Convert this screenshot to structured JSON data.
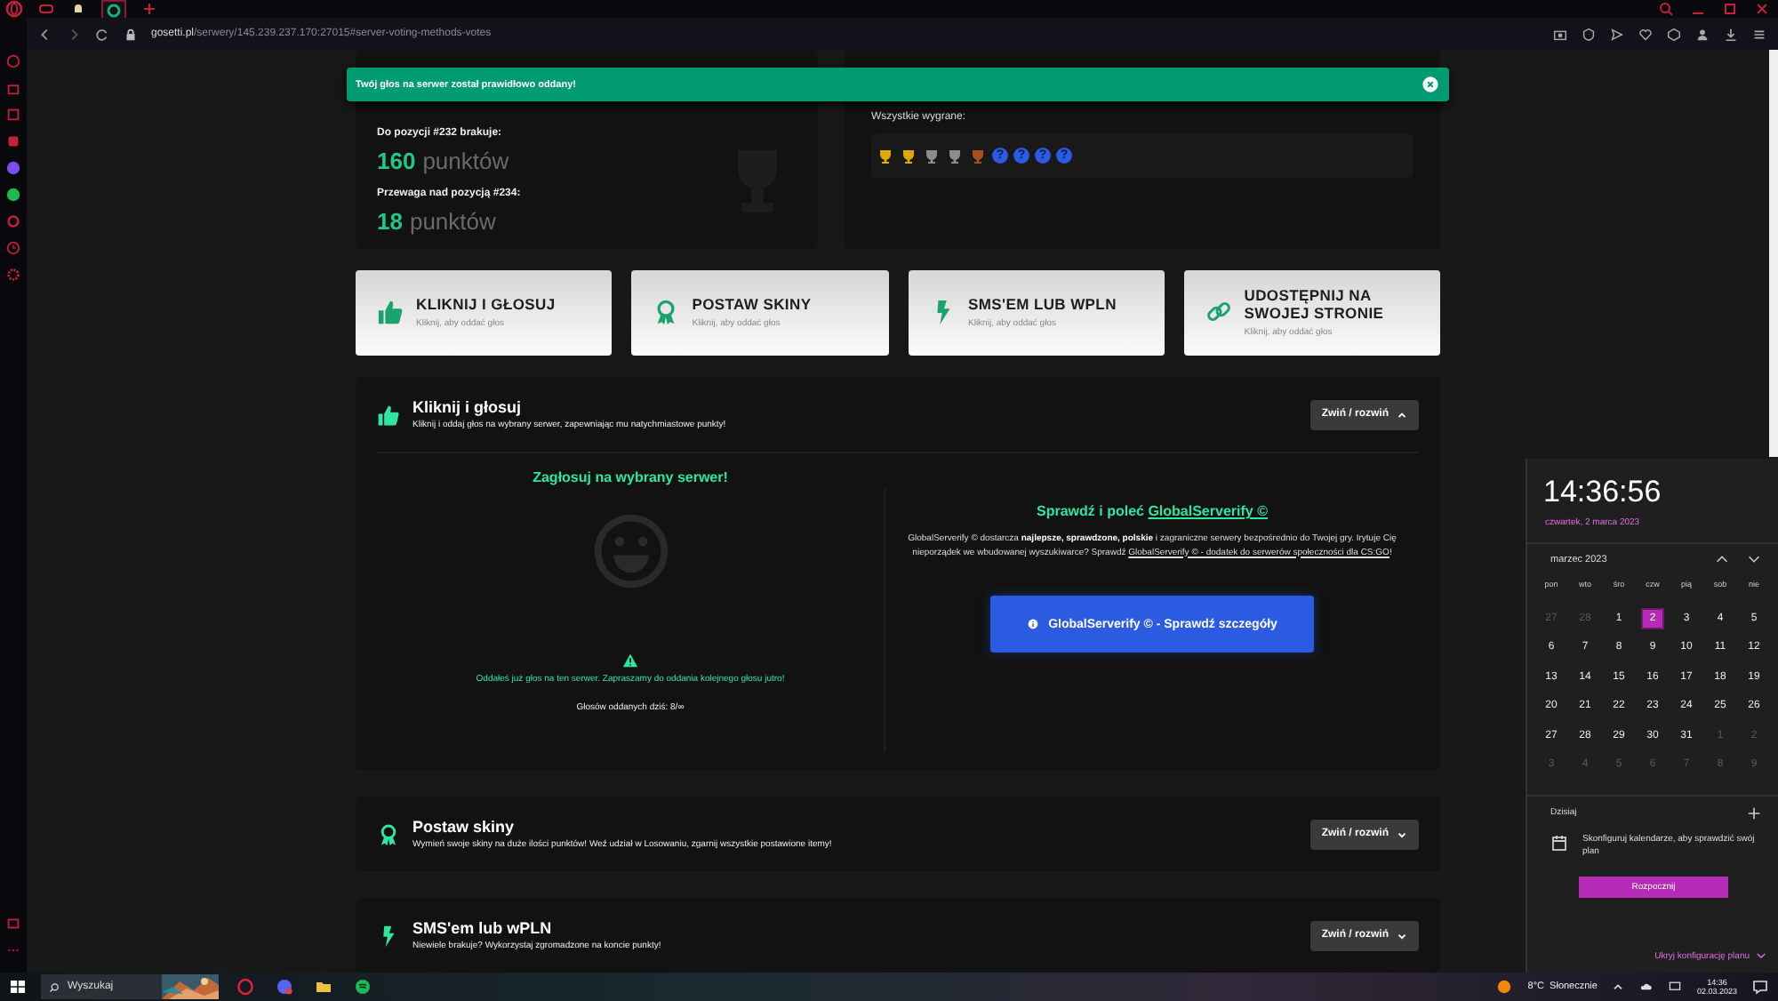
{
  "browser": {
    "url": "**gosetti.pl**/serwery/145.239.237.170:27015#server-voting-methods-votes"
  },
  "toast": {
    "message": "Twój głos na serwer został prawidłowo oddany!"
  },
  "stats": [
    {
      "label": "Do pozycji #232 brakuje:",
      "value": "160",
      "unit": "punktów"
    },
    {
      "label": "Przewaga nad pozycją #234:",
      "value": "18",
      "unit": "punktów"
    }
  ],
  "wins": {
    "label": "Wszystkie wygrane:",
    "items": [
      {
        "kind": "gold"
      },
      {
        "kind": "gold"
      },
      {
        "kind": "silver"
      },
      {
        "kind": "silver"
      },
      {
        "kind": "bronze"
      },
      {
        "kind": "unknown",
        "label": "?"
      },
      {
        "kind": "unknown",
        "label": "?"
      },
      {
        "kind": "unknown",
        "label": "?"
      },
      {
        "kind": "unknown",
        "label": "?"
      }
    ]
  },
  "vote_methods": [
    {
      "kind": "thumb",
      "title": "KLIKNIJ I GŁOSUJ",
      "subtitle": "Kliknij, aby oddać głos"
    },
    {
      "kind": "award",
      "title": "POSTAW SKINY",
      "subtitle": "Kliknij, aby oddać głos"
    },
    {
      "kind": "bolt",
      "title": "SMS'EM LUB WPLN",
      "subtitle": "Kliknij, aby oddać głos"
    },
    {
      "kind": "link",
      "title": "UDOSTĘPNIJ NA SWOJEJ STRONIE",
      "subtitle": "Kliknij, aby oddać głos"
    }
  ],
  "sections": [
    {
      "kind": "thumb",
      "title": "Kliknij i głosuj",
      "description": "Kliknij i oddaj głos na wybrany serwer, zapewniając mu natychmiastowe punkty!",
      "toggle": "Zwiń / rozwiń",
      "expanded": true
    },
    {
      "kind": "award",
      "title": "Postaw skiny",
      "description": "Wymień swoje skiny na duże ilości punktów! Weź udział w Losowaniu, zgarnij wszystkie postawione itemy!",
      "toggle": "Zwiń / rozwiń",
      "expanded": false
    },
    {
      "kind": "bolt",
      "title": "SMS'em lub wPLN",
      "description": "Niewiele brakuje? Wykorzystaj zgromadzone na koncie punkty!",
      "toggle": "Zwiń / rozwiń",
      "expanded": false
    }
  ],
  "vote_panel": {
    "heading": "Zagłosuj na wybrany serwer!",
    "notice": "Oddałeś już głos na ten serwer. Zapraszamy do oddania kolejnego głosu jutro!",
    "count": "Głosów oddanych dziś: 8/∞"
  },
  "promo": {
    "heading": "Sprawdź i poleć ",
    "heading_link": "GlobalServerify ©",
    "text_before": "GlobalServerify © dostarcza **najlepsze, sprawdzone, polskie** i zagraniczne serwery bezpośrednio do Twojej gry. Irytuje Cię nieporządek we wbudowanej wyszukiwarce? Sprawdź ",
    "link": "GlobalServerify © - dodatek do serwerów społeczności dla CS:GO",
    "text_after": "!",
    "button": "GlobalServerify © - Sprawdź szczegóły"
  },
  "calendar": {
    "time": "14:36:56",
    "date": "czwartek, 2 marca 2023",
    "month": "marzec 2023",
    "weekdays": [
      "pon",
      "wto",
      "śro",
      "czw",
      "pią",
      "sob",
      "nie"
    ],
    "days": [
      {
        "day": "27",
        "in_month": false,
        "selected": false
      },
      {
        "day": "28",
        "in_month": false,
        "selected": false
      },
      {
        "day": "1",
        "in_month": true,
        "selected": false
      },
      {
        "day": "2",
        "in_month": true,
        "selected": true
      },
      {
        "day": "3",
        "in_month": true,
        "selected": false
      },
      {
        "day": "4",
        "in_month": true,
        "selected": false
      },
      {
        "day": "5",
        "in_month": true,
        "selected": false
      },
      {
        "day": "6",
        "in_month": true,
        "selected": false
      },
      {
        "day": "7",
        "in_month": true,
        "selected": false
      },
      {
        "day": "8",
        "in_month": true,
        "selected": false
      },
      {
        "day": "9",
        "in_month": true,
        "selected": false
      },
      {
        "day": "10",
        "in_month": true,
        "selected": false
      },
      {
        "day": "11",
        "in_month": true,
        "selected": false
      },
      {
        "day": "12",
        "in_month": true,
        "selected": false
      },
      {
        "day": "13",
        "in_month": true,
        "selected": false
      },
      {
        "day": "14",
        "in_month": true,
        "selected": false
      },
      {
        "day": "15",
        "in_month": true,
        "selected": false
      },
      {
        "day": "16",
        "in_month": true,
        "selected": false
      },
      {
        "day": "17",
        "in_month": true,
        "selected": false
      },
      {
        "day": "18",
        "in_month": true,
        "selected": false
      },
      {
        "day": "19",
        "in_month": true,
        "selected": false
      },
      {
        "day": "20",
        "in_month": true,
        "selected": false
      },
      {
        "day": "21",
        "in_month": true,
        "selected": false
      },
      {
        "day": "22",
        "in_month": true,
        "selected": false
      },
      {
        "day": "23",
        "in_month": true,
        "selected": false
      },
      {
        "day": "24",
        "in_month": true,
        "selected": false
      },
      {
        "day": "25",
        "in_month": true,
        "selected": false
      },
      {
        "day": "26",
        "in_month": true,
        "selected": false
      },
      {
        "day": "27",
        "in_month": true,
        "selected": false
      },
      {
        "day": "28",
        "in_month": true,
        "selected": false
      },
      {
        "day": "29",
        "in_month": true,
        "selected": false
      },
      {
        "day": "30",
        "in_month": true,
        "selected": false
      },
      {
        "day": "31",
        "in_month": true,
        "selected": false
      },
      {
        "day": "1",
        "in_month": false,
        "selected": false
      },
      {
        "day": "2",
        "in_month": false,
        "selected": false
      },
      {
        "day": "3",
        "in_month": false,
        "selected": false
      },
      {
        "day": "4",
        "in_month": false,
        "selected": false
      },
      {
        "day": "5",
        "in_month": false,
        "selected": false
      },
      {
        "day": "6",
        "in_month": false,
        "selected": false
      },
      {
        "day": "7",
        "in_month": false,
        "selected": false
      },
      {
        "day": "8",
        "in_month": false,
        "selected": false
      },
      {
        "day": "9",
        "in_month": false,
        "selected": false
      }
    ],
    "today_label": "Dzisiaj",
    "agenda_text": "Skonfiguruj kalendarze, aby sprawdzić swój plan",
    "agenda_button": "Rozpocznij",
    "hide_link": "Ukryj konfigurację planu"
  },
  "taskbar": {
    "search_placeholder": "Wyszukaj",
    "weather": "8°C  Słonecznie",
    "time": "14:36",
    "date": "02.03.2023"
  }
}
